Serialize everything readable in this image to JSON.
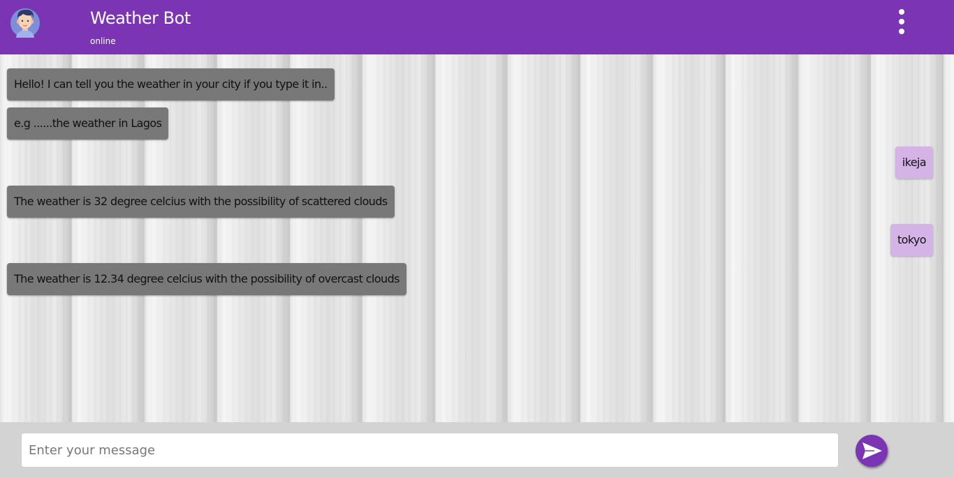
{
  "header": {
    "title": "Weather Bot",
    "status": "online",
    "avatar_icon": "user-avatar-icon",
    "menu_icon": "more-vertical-icon",
    "color": "#7b35b4"
  },
  "messages": [
    {
      "sender": "bot",
      "text": "Hello! I can tell you the weather in your city if you type it in.."
    },
    {
      "sender": "bot",
      "text": "e.g ......the weather in Lagos"
    },
    {
      "sender": "user",
      "text": "ikeja"
    },
    {
      "sender": "bot",
      "text": "The weather is 32 degree celcius with the possibility of scattered clouds"
    },
    {
      "sender": "user",
      "text": "tokyo"
    },
    {
      "sender": "bot",
      "text": "The weather is 12.34 degree celcius with the possibility of overcast clouds"
    }
  ],
  "composer": {
    "placeholder": "Enter your message",
    "value": "",
    "send_icon": "send-icon"
  },
  "colors": {
    "accent": "#7b35b4",
    "bot_bubble": "#787878",
    "user_bubble": "#d4b4e6"
  }
}
